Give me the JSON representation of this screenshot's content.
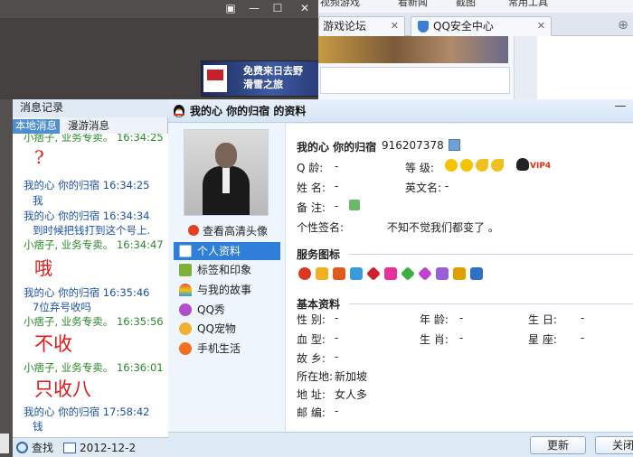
{
  "dark_window": {
    "ad_text_line1": "免费来日去野",
    "ad_text_line2": "滑雪之旅",
    "ad_logo": "THE NORTH FACE"
  },
  "browser": {
    "menu": [
      "视频游戏",
      "看新闻",
      "截图",
      "常用工具"
    ],
    "tabs": [
      {
        "label": "游戏论坛"
      },
      {
        "label": "QQ安全中心"
      }
    ]
  },
  "history": {
    "title": "消息记录",
    "tabs": [
      "本地消息",
      "漫游消息"
    ],
    "messages": [
      {
        "head": "小痞子, 业务专卖。 16:34:25",
        "body": ""
      },
      {
        "big": "?"
      },
      {
        "head": "我的心 你的归宿  16:34:25",
        "body": "我"
      },
      {
        "head": "我的心 你的归宿  16:34:34",
        "body": "到时候把钱打到这个号上."
      },
      {
        "head": "小痞子, 业务专卖。 16:34:47",
        "body": ""
      },
      {
        "big": "哦"
      },
      {
        "head": "我的心 你的归宿  16:35:46",
        "body": "7位弃号收吗"
      },
      {
        "head": "小痞子, 业务专卖。 16:35:56",
        "body": ""
      },
      {
        "big": "不收"
      },
      {
        "head": "小痞子, 业务专卖。 16:36:01",
        "body": ""
      },
      {
        "big": "只收八"
      },
      {
        "head": "我的心 你的归宿  17:58:42",
        "body": "钱"
      }
    ],
    "find_label": "查找",
    "date": "2012-12-2"
  },
  "profile": {
    "window_title": "我的心 你的归宿 的资料",
    "view_hd": "查看高清头像",
    "side_items": [
      "个人资料",
      "标签和印象",
      "与我的故事",
      "QQ秀",
      "QQ宠物",
      "手机生活"
    ],
    "nickname": "我的心 你的归宿",
    "qq_number": "916207378",
    "q_age_label": "Q   龄:",
    "q_age": "-",
    "level_label": "等   级:",
    "name_label": "姓   名:",
    "name": "-",
    "en_name_label": "英文名:",
    "en_name": "-",
    "remark_label": "备   注:",
    "remark": "-",
    "signature_label": "个性签名:",
    "signature": "不知不觉我们都变了 。",
    "service_title": "服务图标",
    "basic_title": "基本资料",
    "gender_label": "性   别:",
    "gender": "-",
    "age_label": "年   龄:",
    "age": "-",
    "birthday_label": "生     日:",
    "birthday": "-",
    "blood_label": "血   型:",
    "blood": "-",
    "zodiac_label": "生   肖:",
    "zodiac": "-",
    "star_label": "星     座:",
    "star": "-",
    "hometown_label": "故   乡:",
    "hometown": "-",
    "location_label": "所在地:",
    "location": "新加坡",
    "address_label": "地   址:",
    "address": "女人多",
    "postcode_label": "邮   编:",
    "postcode": "-",
    "vip_label": "VIP4",
    "buttons": {
      "refresh": "更新",
      "close": "关闭"
    }
  },
  "colors": {
    "accent": "#2f7ed8",
    "history_blue": "#1a52a8",
    "history_green": "#2a8a2a",
    "big_red": "#e01818"
  }
}
